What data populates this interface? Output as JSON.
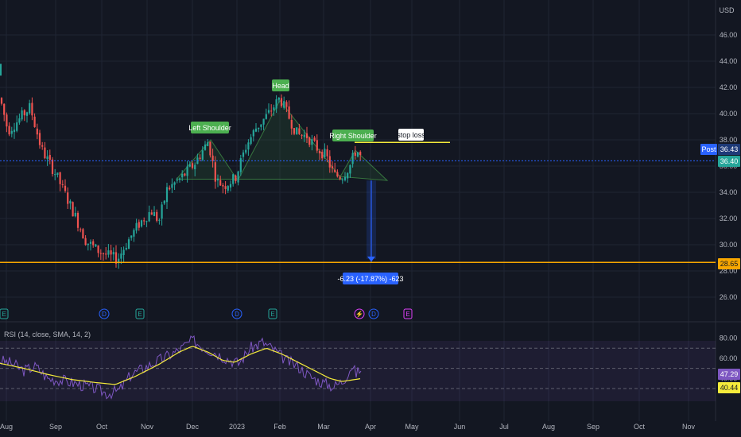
{
  "currency": "USD",
  "price_axis": {
    "ticks": [
      "46.00",
      "44.00",
      "42.00",
      "40.00",
      "38.00",
      "36.00",
      "34.00",
      "32.00",
      "30.00",
      "28.00",
      "26.00"
    ],
    "labels": [
      {
        "text": "Post",
        "value": 36.43,
        "kind": "post"
      },
      {
        "text": "36.43",
        "value": 36.43,
        "kind": "post-value"
      },
      {
        "text": "36.40",
        "value": 36.4,
        "kind": "last"
      },
      {
        "text": "28.65",
        "value": 28.65,
        "kind": "support"
      }
    ]
  },
  "rsi_axis": {
    "ticks": [
      "80.00",
      "60.00",
      "40.00"
    ],
    "labels": [
      {
        "text": "47.29",
        "value": 47.29,
        "kind": "rsi"
      },
      {
        "text": "40.44",
        "value": 40.44,
        "kind": "rsi-sma"
      }
    ]
  },
  "rsi_legend": "RSI (14, close, SMA, 14, 2)",
  "time_axis": [
    "Aug",
    "Sep",
    "Oct",
    "Nov",
    "Dec",
    "2023",
    "Feb",
    "Mar",
    "Apr",
    "May",
    "Jun",
    "Jul",
    "Aug",
    "Sep",
    "Oct",
    "Nov"
  ],
  "annotations": {
    "left_shoulder": "Left Shoulder",
    "head": "Head",
    "right_shoulder": "Right Shoulder",
    "stop_loss": "stop loss",
    "measure": "-6.23 (-17.87%) -623"
  },
  "event_markers": [
    "E",
    "D",
    "E",
    "D",
    "E",
    "⚡",
    "D",
    "E"
  ],
  "colors": {
    "background": "#131722",
    "up": "#26a69a",
    "down": "#ef5350",
    "support": "#f7a600",
    "stop_loss": "#f5eb3b",
    "last_price": "#2962ff",
    "rsi": "#7e57c2",
    "rsi_sma": "#f5eb3b",
    "label_green": "#4caf50",
    "measure": "#2962ff"
  },
  "chart_data": {
    "type": "candlestick",
    "price_range": [
      25.3,
      47.6
    ],
    "rsi_range": [
      18,
      82
    ],
    "last_close": 36.4,
    "post_price": 36.43,
    "support_level": 28.65,
    "stop_loss_level": 37.8,
    "measured_move": "-6.23 (-17.87%) -623"
  }
}
